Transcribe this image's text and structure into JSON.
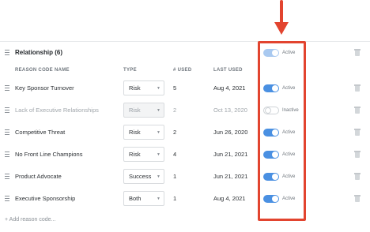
{
  "group": {
    "title": "Relationship",
    "count": "(6)",
    "status": "Active",
    "enabled": true
  },
  "columns": {
    "name": "REASON CODE NAME",
    "type": "TYPE",
    "used": "# USED",
    "last": "LAST USED"
  },
  "rows": [
    {
      "name": "Key Sponsor Turnover",
      "type": "Risk",
      "used": "5",
      "last": "Aug 4, 2021",
      "status": "Active",
      "enabled": true
    },
    {
      "name": "Lack of Executive Relationships",
      "type": "Risk",
      "used": "2",
      "last": "Oct 13, 2020",
      "status": "Inactive",
      "enabled": false
    },
    {
      "name": "Competitive Threat",
      "type": "Risk",
      "used": "2",
      "last": "Jun 26, 2020",
      "status": "Active",
      "enabled": true
    },
    {
      "name": "No Front Line Champions",
      "type": "Risk",
      "used": "4",
      "last": "Jun 21, 2021",
      "status": "Active",
      "enabled": true
    },
    {
      "name": "Product Advocate",
      "type": "Success",
      "used": "1",
      "last": "Jun 21, 2021",
      "status": "Active",
      "enabled": true
    },
    {
      "name": "Executive Sponsorship",
      "type": "Both",
      "used": "1",
      "last": "Aug 4, 2021",
      "status": "Active",
      "enabled": true
    }
  ],
  "add_link": "+ Add reason code...",
  "icons": {
    "drag": "drag-handle-icon",
    "caret": "chevron-down-icon",
    "delete": "trash-icon",
    "arrow": "arrow-down-icon"
  },
  "colors": {
    "accent": "#4a90e2",
    "highlight": "#e2442f"
  }
}
